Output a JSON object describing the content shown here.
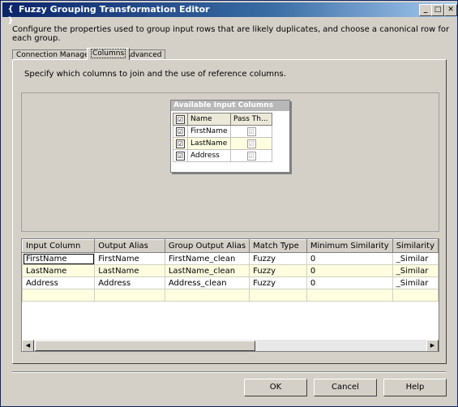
{
  "window": {
    "title": "Fuzzy Grouping Transformation Editor",
    "icon_glyph": "{ }",
    "min_glyph": "_",
    "max_glyph": "□",
    "close_glyph": "✕"
  },
  "description": "Configure the properties used to group input rows that are likely duplicates, and choose a canonical row for each group.",
  "tabs": [
    {
      "label": "Connection Manager",
      "active": false
    },
    {
      "label": "Columns",
      "active": true
    },
    {
      "label": "Advanced",
      "active": false
    }
  ],
  "panel": {
    "instructions": "Specify which columns to join and the use of reference columns."
  },
  "available_columns": {
    "title": "Available Input Columns",
    "headers": {
      "check": "☑",
      "name": "Name",
      "pass": "Pass Th..."
    },
    "rows": [
      {
        "name": "FirstName",
        "checked": "☑",
        "pass": "☑"
      },
      {
        "name": "LastName",
        "checked": "☑",
        "pass": "☑"
      },
      {
        "name": "Address",
        "checked": "☑",
        "pass": "☑"
      }
    ]
  },
  "grid": {
    "headers": [
      "Input Column",
      "Output Alias",
      "Group Output Alias",
      "Match Type",
      "Minimum Similarity",
      "Similarity"
    ],
    "rows": [
      [
        "FirstName",
        "FirstName",
        "FirstName_clean",
        "Fuzzy",
        "0",
        "_Similar"
      ],
      [
        "LastName",
        "LastName",
        "LastName_clean",
        "Fuzzy",
        "0",
        "_Similar"
      ],
      [
        "Address",
        "Address",
        "Address_clean",
        "Fuzzy",
        "0",
        "_Similar"
      ],
      [
        "",
        "",
        "",
        "",
        "",
        ""
      ]
    ],
    "scroll_left": "◀",
    "scroll_right": "▶"
  },
  "buttons": {
    "ok": "OK",
    "cancel": "Cancel",
    "help": "Help"
  }
}
